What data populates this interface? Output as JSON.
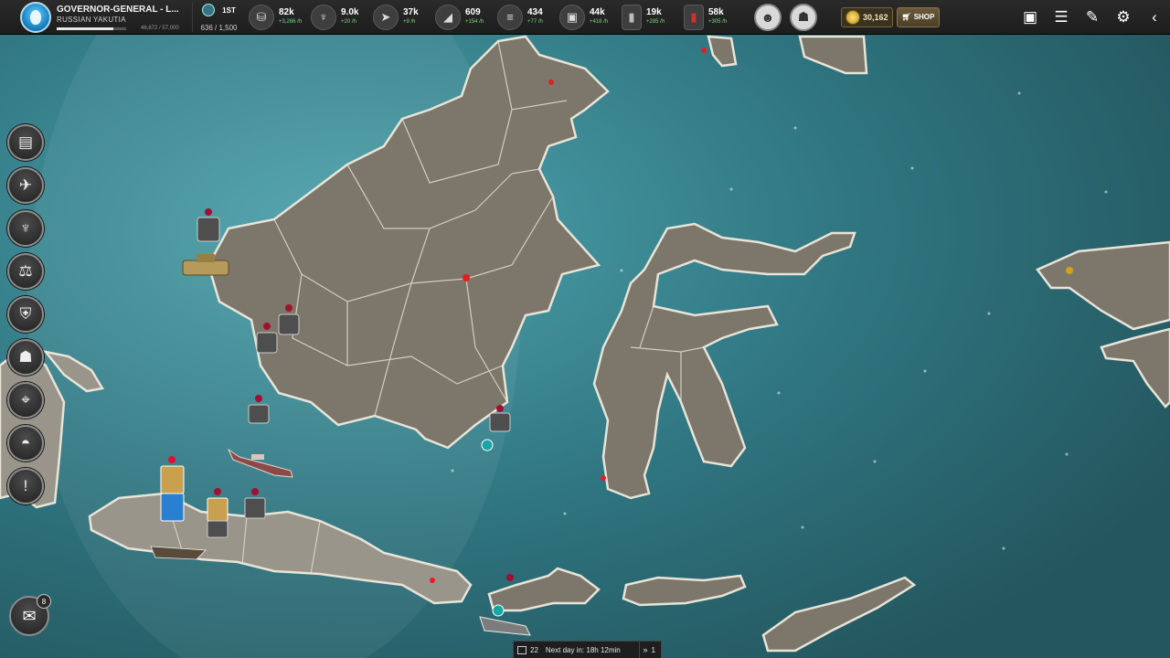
{
  "player": {
    "title": "GOVERNOR-GENERAL - L...",
    "nation": "RUSSIAN YAKUTIA",
    "xp_text": "46,672 / 57,000",
    "xp_progress": 0.82,
    "rank": "1ST",
    "population": "636 / 1,500"
  },
  "resources": [
    {
      "name": "money",
      "icon": "coins-icon",
      "glyph": "⛁",
      "value": "82k",
      "rate": "+3,266 /h"
    },
    {
      "name": "food",
      "icon": "wheat-icon",
      "glyph": "♆",
      "value": "9.0k",
      "rate": "+20 /h"
    },
    {
      "name": "fish",
      "icon": "fish-icon",
      "glyph": "➤",
      "value": "37k",
      "rate": "+9 /h"
    },
    {
      "name": "iron",
      "icon": "iron-icon",
      "glyph": "◢",
      "value": "609",
      "rate": "+154 /h"
    },
    {
      "name": "wood",
      "icon": "lumber-icon",
      "glyph": "≡",
      "value": "434",
      "rate": "+77 /h"
    },
    {
      "name": "goods",
      "icon": "crate-icon",
      "glyph": "▣",
      "value": "44k",
      "rate": "+418 /h"
    },
    {
      "name": "oil",
      "icon": "barrel-icon",
      "glyph": "▮",
      "value": "19k",
      "rate": "+285 /h"
    },
    {
      "name": "fuel",
      "icon": "jerrycan-icon",
      "glyph": "▮",
      "value": "58k",
      "rate": "+305 /h"
    }
  ],
  "gold": "30,162",
  "shop_label": "SHOP",
  "left_menu": [
    {
      "name": "newspaper-icon",
      "glyph": "▤"
    },
    {
      "name": "dove-icon",
      "glyph": "✈"
    },
    {
      "name": "wheat-icon",
      "glyph": "♆"
    },
    {
      "name": "scales-icon",
      "glyph": "⚖"
    },
    {
      "name": "shield-icon",
      "glyph": "⛨"
    },
    {
      "name": "spy-icon",
      "glyph": "☗"
    },
    {
      "name": "map-marker-icon",
      "glyph": "⌖"
    },
    {
      "name": "helmet-icon",
      "glyph": "◓"
    },
    {
      "name": "alert-icon",
      "glyph": "!"
    }
  ],
  "chat_badge": "8",
  "day": {
    "number": "22",
    "next_day_text": "Next day in: 18h 12min",
    "speed": "1"
  },
  "colors": {
    "sea": "#2d6b73",
    "land": "#7c766b",
    "border": "#e8e4d8"
  }
}
